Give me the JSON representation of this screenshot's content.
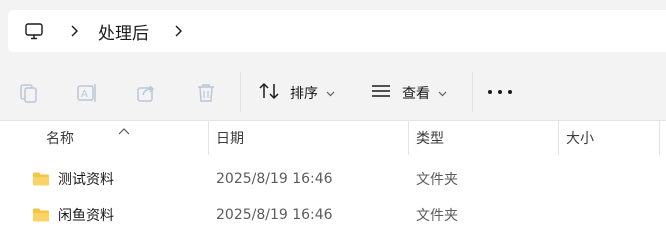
{
  "address": {
    "location_icon": "computer-icon",
    "breadcrumb": "处理后"
  },
  "toolbar": {
    "icons": [
      "copy-icon",
      "rename-icon",
      "share-icon",
      "delete-icon"
    ],
    "sort_label": "排序",
    "view_label": "查看",
    "more_icon": "more-icon"
  },
  "columns": {
    "name": "名称",
    "date": "日期",
    "type": "类型",
    "size": "大小"
  },
  "files": [
    {
      "name": "测试资料",
      "date": "2025/8/19 16:46",
      "type": "文件夹",
      "size": ""
    },
    {
      "name": "闲鱼资料",
      "date": "2025/8/19 16:46",
      "type": "文件夹",
      "size": ""
    }
  ],
  "colors": {
    "folder": "#f6c343",
    "disabled_icon": "#b9c7d8"
  }
}
